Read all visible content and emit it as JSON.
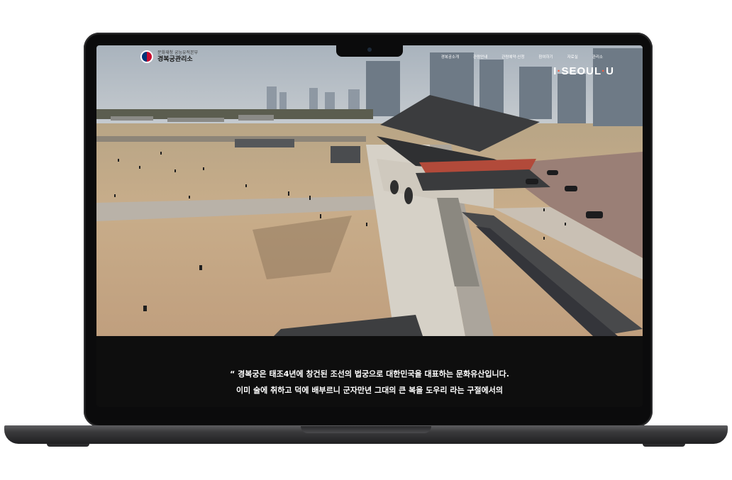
{
  "header": {
    "org_sub": "문화재청 궁능유적본부",
    "org_name": "경복궁관리소",
    "nav": [
      "경복궁소개",
      "관람안내",
      "관람예약·신청",
      "참여하기",
      "자료실",
      "관리소"
    ],
    "brand_left": "I",
    "brand_dot": "·",
    "brand_mid": "SEOUL",
    "brand_right": "U"
  },
  "caption": {
    "line1": "“ 경복궁은 태조4년에 창건된 조선의 법궁으로 대한민국을 대표하는 문화유산입니다.",
    "line2": "이미 술에 취하고 덕에 배부르니 군자만년 그대의 큰 복을 도우리 라는 구절에서의"
  },
  "colors": {
    "taegeuk_red": "#c60c30",
    "taegeuk_blue": "#003478",
    "brand_accent": "#ff5a3c",
    "screen_bg": "#0e0e0e"
  }
}
